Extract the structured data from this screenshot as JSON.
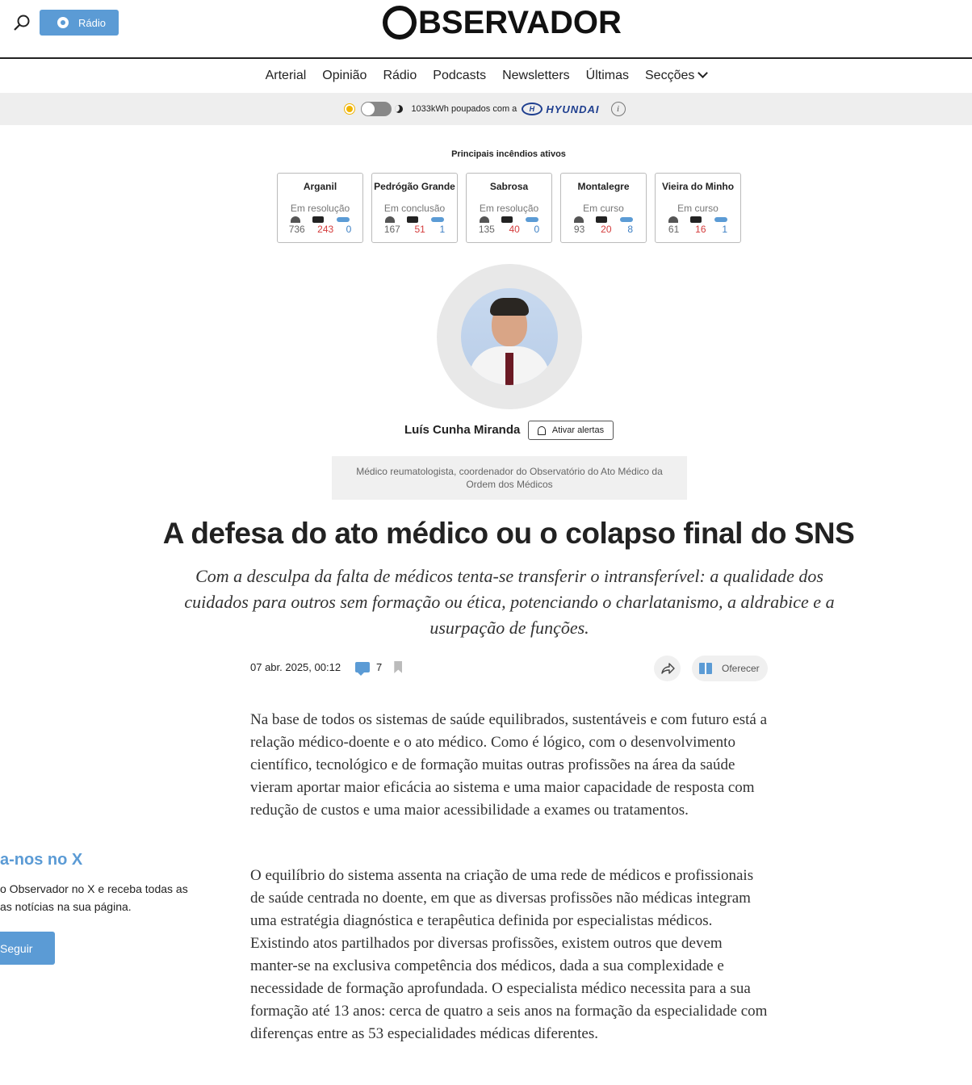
{
  "header": {
    "radio_label": "Rádio",
    "logo_text": "BSERVADOR"
  },
  "nav": {
    "items": [
      "Arterial",
      "Opinião",
      "Rádio",
      "Podcasts",
      "Newsletters",
      "Últimas",
      "Secções"
    ]
  },
  "eco_banner": {
    "text": "1033kWh poupados com a",
    "brand": "HYUNDAI",
    "info": "i"
  },
  "fires": {
    "title": "Principais incêndios ativos",
    "cards": [
      {
        "name": "Arganil",
        "status": "Em resolução",
        "people": "736",
        "trucks": "243",
        "air": "0"
      },
      {
        "name": "Pedrógão Grande",
        "status": "Em conclusão",
        "people": "167",
        "trucks": "51",
        "air": "1"
      },
      {
        "name": "Sabrosa",
        "status": "Em resolução",
        "people": "135",
        "trucks": "40",
        "air": "0"
      },
      {
        "name": "Montalegre",
        "status": "Em curso",
        "people": "93",
        "trucks": "20",
        "air": "8"
      },
      {
        "name": "Vieira do Minho",
        "status": "Em curso",
        "people": "61",
        "trucks": "16",
        "air": "1"
      }
    ]
  },
  "author": {
    "name": "Luís Cunha Miranda",
    "alert_label": "Ativar alertas",
    "bio": "Médico reumatologista, coordenador do Observatório do Ato Médico da Ordem dos Médicos"
  },
  "article": {
    "headline": "A defesa do ato médico ou o colapso final do SNS",
    "lead": "Com a desculpa da falta de médicos tenta-se transferir o intransferível: a qualidade dos cuidados para outros sem formação ou ética, potenciando o charlatanismo, a aldrabice e a usurpação de funções.",
    "date": "07 abr. 2025, 00:12",
    "comments": "7",
    "offer_label": "Oferecer",
    "paragraphs": [
      "Na base de todos os sistemas de saúde equilibrados, sustentáveis e com futuro está a relação médico-doente e o ato médico. Como é lógico, com o desenvolvimento científico, tecnológico e de formação muitas outras profissões na área da saúde vieram aportar maior eficácia ao sistema e uma maior capacidade de resposta com redução de custos e uma maior acessibilidade a exames ou tratamentos.",
      "O equilíbrio do sistema assenta na criação de uma rede de médicos e profissionais de saúde centrada no doente, em que as diversas profissões não médicas integram uma estratégia diagnóstica e terapêutica definida por especialistas médicos. Existindo atos partilhados por diversas profissões, existem outros que devem manter-se na exclusiva competência dos médicos, dada a sua complexidade e necessidade de formação aprofundada. O especialista médico necessita para a sua formação até 13 anos: cerca de quatro a seis anos na formação da especialidade com diferenças entre as 53 especialidades médicas diferentes."
    ]
  },
  "x_promo": {
    "title": "a-nos no X",
    "text": "o Observador no X e receba todas as\nas notícias na sua página.",
    "follow_label": "Seguir"
  },
  "colors": {
    "accent": "#5b9bd5",
    "red": "#d43c3c",
    "blue": "#3c7fc4",
    "hyundai": "#1f3f8f"
  }
}
